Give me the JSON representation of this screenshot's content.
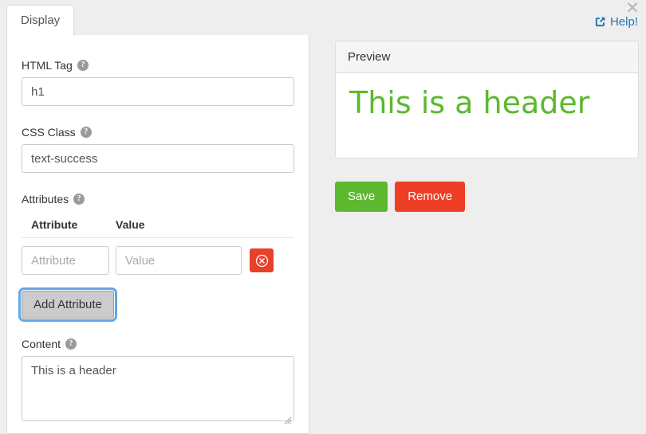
{
  "window": {
    "close_icon": "close-icon",
    "help_label": "Help!",
    "help_icon": "external-link-icon"
  },
  "tabs": [
    {
      "label": "Display",
      "active": true
    }
  ],
  "form": {
    "html_tag": {
      "label": "HTML Tag",
      "help_icon": "question-mark-icon",
      "value": "h1",
      "placeholder": ""
    },
    "css_class": {
      "label": "CSS Class",
      "help_icon": "question-mark-icon",
      "value": "text-success",
      "placeholder": ""
    },
    "attributes": {
      "label": "Attributes",
      "help_icon": "question-mark-icon",
      "columns": [
        "Attribute",
        "Value"
      ],
      "rows": [
        {
          "attribute_value": "",
          "attribute_placeholder": "Attribute",
          "value_value": "",
          "value_placeholder": "Value",
          "delete_icon": "circle-x-icon"
        }
      ],
      "add_button_label": "Add Attribute"
    },
    "content": {
      "label": "Content",
      "help_icon": "question-mark-icon",
      "value": "This is a header",
      "placeholder": ""
    }
  },
  "preview": {
    "title": "Preview",
    "heading_text": "This is a header"
  },
  "actions": {
    "save_label": "Save",
    "remove_label": "Remove"
  },
  "colors": {
    "accent_green": "#5cb82f",
    "accent_red": "#ee3f26",
    "delete_red": "#e8412a",
    "link_blue": "#1d78b5",
    "focus_blue": "#5fa8e8",
    "page_bg": "#eeeeee"
  }
}
